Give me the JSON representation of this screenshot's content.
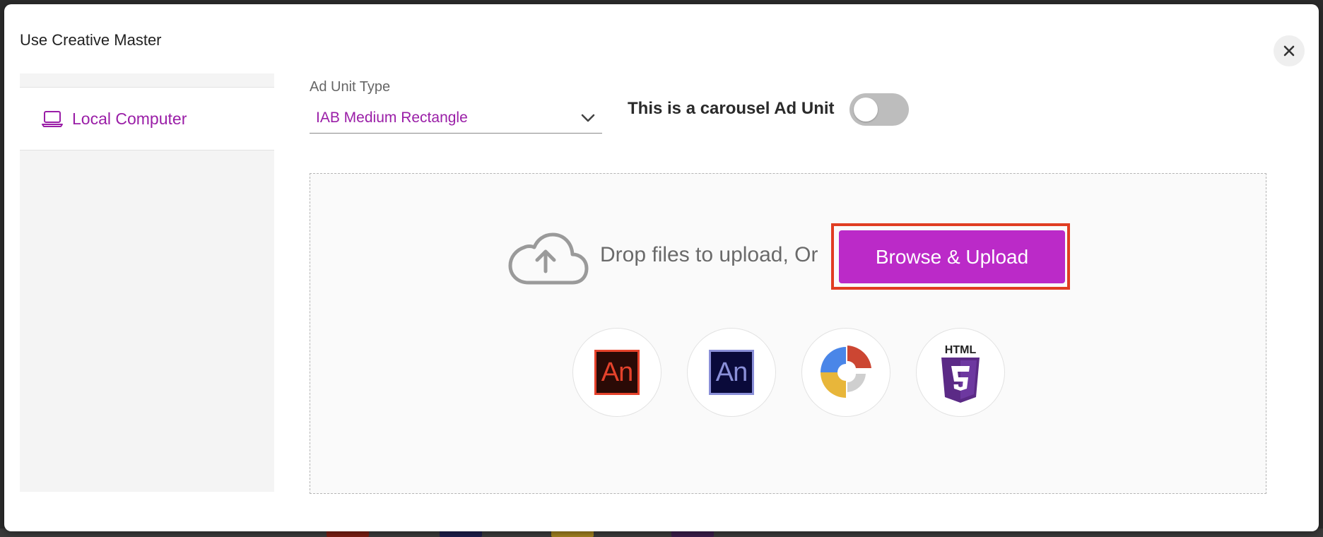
{
  "modal": {
    "title": "Use Creative Master",
    "close_label": "✕"
  },
  "sidebar": {
    "items": [
      {
        "label": "Local Computer",
        "icon": "laptop-icon",
        "active": true
      }
    ]
  },
  "form": {
    "ad_unit_type_label": "Ad Unit Type",
    "ad_unit_type_value": "IAB Medium Rectangle",
    "carousel_label": "This is a carousel Ad Unit",
    "carousel_enabled": false
  },
  "upload": {
    "drop_text": "Drop files to upload, Or",
    "browse_label": "Browse & Upload"
  },
  "tools": [
    {
      "name": "adobe-animate-icon",
      "text": "An"
    },
    {
      "name": "adobe-edge-animate-icon",
      "text": "An"
    },
    {
      "name": "google-web-designer-icon"
    },
    {
      "name": "html5-icon",
      "text": "HTML"
    }
  ],
  "colors": {
    "accent": "#bb2ac8",
    "accent_text": "#9a1ea7",
    "highlight": "#e03d22"
  }
}
